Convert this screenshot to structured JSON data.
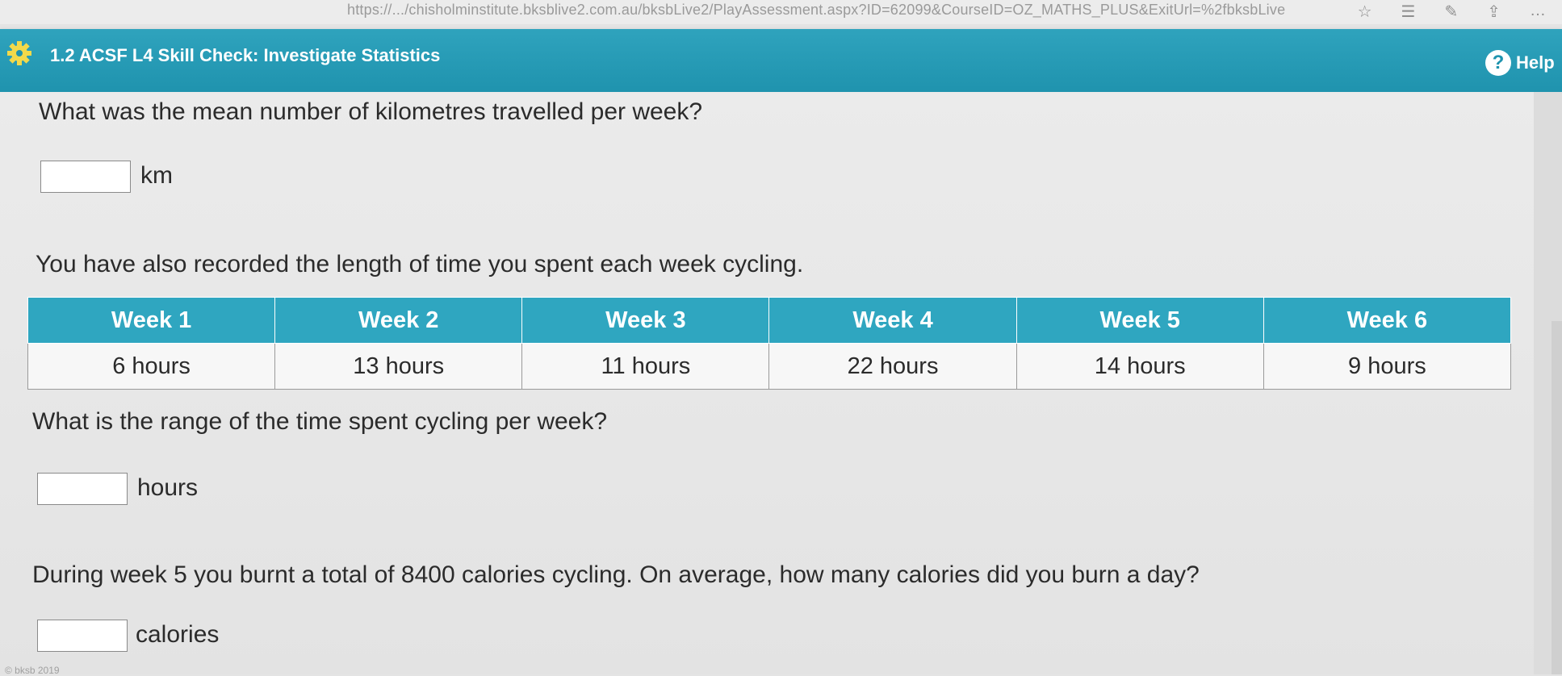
{
  "browser": {
    "url": "https://.../chisholminstitute.bksblive2.com.au/bksbLive2/PlayAssessment.aspx?ID=62099&CourseID=OZ_MATHS_PLUS&ExitUrl=%2fbksbLive",
    "icons": [
      "star-icon",
      "favorites-icon",
      "pen-icon",
      "share-icon",
      "more-icon"
    ]
  },
  "header": {
    "title": "1.2 ACSF L4 Skill Check: Investigate Statistics",
    "help_label": "Help",
    "help_glyph": "?",
    "color": "#2fa3bd"
  },
  "question1": {
    "text": "What was the mean number of kilometres travelled per week?",
    "answer_value": "",
    "unit": "km"
  },
  "intro2": {
    "text": "You have also recorded the length of time you spent each week cycling."
  },
  "table": {
    "headers": [
      "Week 1",
      "Week 2",
      "Week 3",
      "Week 4",
      "Week 5",
      "Week 6"
    ],
    "cells": [
      "6 hours",
      "13 hours",
      "11 hours",
      "22 hours",
      "14 hours",
      "9 hours"
    ]
  },
  "question2": {
    "text": "What is the range of the time spent cycling per week?",
    "answer_value": "",
    "unit": "hours"
  },
  "question3": {
    "text": "During week 5 you burnt a total of 8400 calories cycling. On average, how many calories did you burn a day?",
    "answer_value": "",
    "unit": "calories"
  },
  "footer": {
    "text": "© bksb 2019"
  }
}
